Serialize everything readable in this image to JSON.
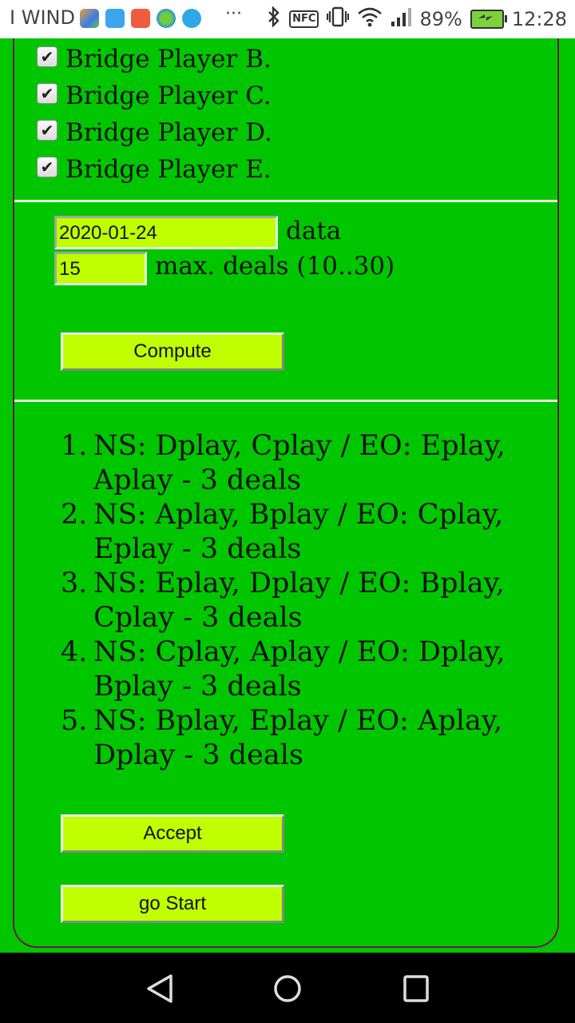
{
  "status_bar": {
    "carrier": "I WIND",
    "overflow": "···",
    "nfc": "NFC",
    "battery": "89%",
    "time": "12:28",
    "icons": [
      "bluetooth-icon",
      "nfc-icon",
      "vibrate-icon",
      "wifi-icon",
      "signal-icon",
      "battery-charging-icon"
    ]
  },
  "players": [
    {
      "label": "Bridge Player B.",
      "checked": true
    },
    {
      "label": "Bridge Player C.",
      "checked": true
    },
    {
      "label": "Bridge Player D.",
      "checked": true
    },
    {
      "label": "Bridge Player E.",
      "checked": true
    }
  ],
  "inputs": {
    "date_value": "2020-01-24",
    "date_label": "data",
    "deals_value": "15",
    "deals_label": "max. deals (10..30)"
  },
  "buttons": {
    "compute": "Compute",
    "accept": "Accept",
    "go_start": "go Start"
  },
  "results": [
    {
      "num": "1.",
      "text": "NS: Dplay, Cplay / EO: Eplay, Aplay - 3 deals"
    },
    {
      "num": "2.",
      "text": "NS: Aplay, Bplay / EO: Cplay, Eplay - 3 deals"
    },
    {
      "num": "3.",
      "text": "NS: Eplay, Dplay / EO: Bplay, Cplay - 3 deals"
    },
    {
      "num": "4.",
      "text": "NS: Cplay, Aplay / EO: Dplay, Bplay - 3 deals"
    },
    {
      "num": "5.",
      "text": "NS: Bplay, Eplay / EO: Aplay, Dplay - 3 deals"
    }
  ],
  "colors": {
    "background": "#00c600",
    "field": "#bfff00",
    "frame_border": "#6a1a4a"
  }
}
